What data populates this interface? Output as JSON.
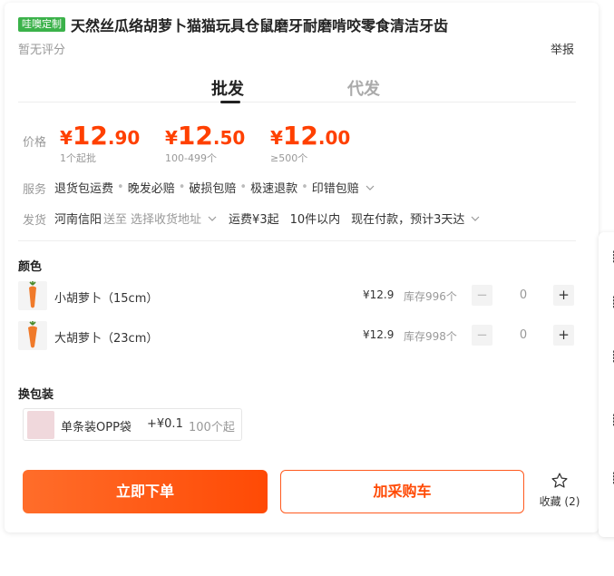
{
  "product": {
    "tag": "哇噢定制",
    "title": "天然丝瓜络胡萝卜猫猫玩具仓鼠磨牙耐磨啃咬零食清洁牙齿",
    "rating": "暂无评分",
    "report": "举报"
  },
  "tabs": [
    {
      "label": "批发",
      "active": true
    },
    {
      "label": "代发",
      "active": false
    }
  ],
  "price": {
    "label": "价格",
    "tiers": [
      {
        "currency": "¥",
        "int": "12",
        "dec": ".90",
        "min": "1个起批"
      },
      {
        "currency": "¥",
        "int": "12",
        "dec": ".50",
        "min": "100-499个"
      },
      {
        "currency": "¥",
        "int": "12",
        "dec": ".00",
        "min": "≥500个"
      }
    ]
  },
  "service": {
    "label": "服务",
    "items": [
      "退货包运费",
      "晚发必赔",
      "破损包赔",
      "极速退款",
      "印错包赔"
    ],
    "sep": "•"
  },
  "shipping": {
    "label": "发货",
    "origin": "河南信阳",
    "to": "送至",
    "address_placeholder": "选择收货地址",
    "fee": "运费¥3起",
    "qty": "10件以内",
    "eta": "现在付款，预计3天达"
  },
  "color_section": {
    "title": "颜色",
    "skus": [
      {
        "name": "小胡萝卜（15cm）",
        "price": "¥12.9",
        "stock": "库存996个",
        "qty": "0"
      },
      {
        "name": "大胡萝卜（23cm）",
        "price": "¥12.9",
        "stock": "库存998个",
        "qty": "0"
      }
    ]
  },
  "packaging": {
    "title": "换包装",
    "option": {
      "name": "单条装OPP袋",
      "price": "+¥0.1",
      "min": "100个起"
    }
  },
  "actions": {
    "order": "立即下单",
    "cart": "加采购车",
    "favorite": "收藏 (2)"
  },
  "colors": {
    "accent": "#ff4a05",
    "tag_green": "#3bb24a"
  }
}
